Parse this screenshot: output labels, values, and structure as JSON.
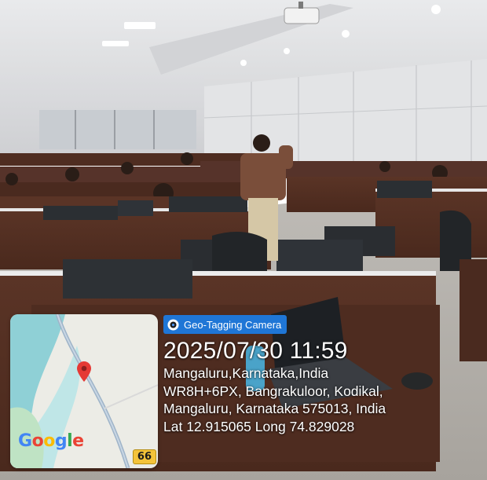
{
  "overlay": {
    "app_name": "Geo-Tagging Camera",
    "datetime": "2025/07/30 11:59",
    "city_line": "Mangaluru,Karnataka,India",
    "address_line1": "WR8H+6PX, Bangrakuloor, Kodikal,",
    "address_line2": "Mangaluru, Karnataka 575013, India",
    "coords_line": "Lat 12.915065 Long 74.829028",
    "map_provider_logo": "Google",
    "road_badge": "66",
    "icons": [
      "camera-icon",
      "map-pin-icon"
    ]
  },
  "colors": {
    "tag_bg": "#1f76d6",
    "overlay_text": "#ffffff",
    "pin": "#e53935",
    "badge": "#f4c33a"
  }
}
